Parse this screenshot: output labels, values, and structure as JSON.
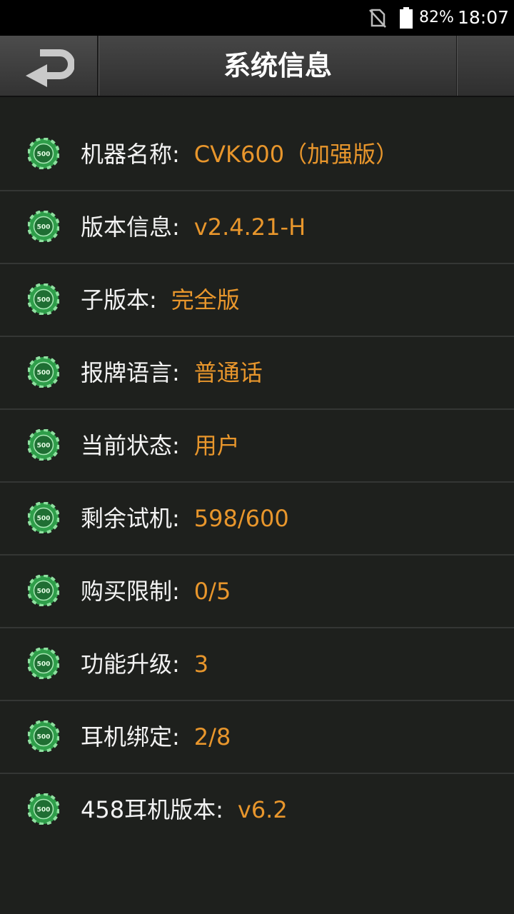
{
  "status_bar": {
    "battery": "82%",
    "time": "18:07",
    "icons": [
      "no-sim-icon",
      "battery-icon"
    ]
  },
  "header": {
    "title": "系统信息",
    "back_icon": "return-arrow-icon"
  },
  "info_rows": [
    {
      "label": "机器名称:",
      "value": "CVK600（加强版）"
    },
    {
      "label": "版本信息:",
      "value": "v2.4.21-H"
    },
    {
      "label": "子版本:",
      "value": "完全版"
    },
    {
      "label": "报牌语言:",
      "value": "普通话"
    },
    {
      "label": "当前状态:",
      "value": "用户"
    },
    {
      "label": "剩余试机:",
      "value": "598/600"
    },
    {
      "label": "购买限制:",
      "value": "0/5"
    },
    {
      "label": "功能升级:",
      "value": "3"
    },
    {
      "label": "耳机绑定:",
      "value": "2/8"
    },
    {
      "label": "458耳机版本:",
      "value": "v6.2"
    }
  ],
  "chip": {
    "icon": "poker-chip-icon",
    "text": "500"
  },
  "colors": {
    "background": "#1e201d",
    "label": "#f3f3f3",
    "value": "#e8962c",
    "chip": "#2f9e4a"
  }
}
